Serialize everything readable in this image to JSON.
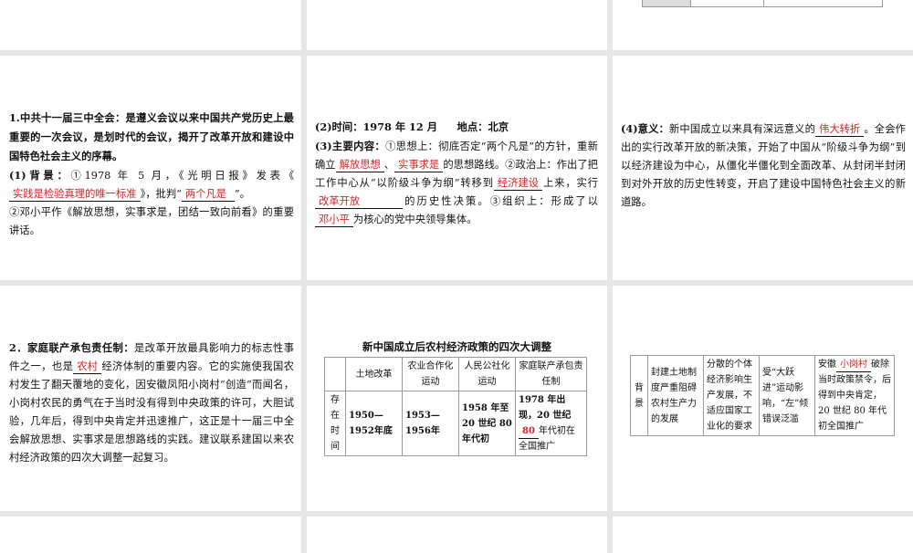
{
  "slides": {
    "s1": {
      "heading": "1.中共十一届三中全会：",
      "text1": "是遵义会议以来中国共产党历史上最重要的一次会议，是划时代的会议，揭开了改革开放和建设中国特色社会主义的序幕。",
      "bg_label": "(1)背景：",
      "bg_text1": "①1978 年 5 月，《光明日报》发表《",
      "blank1": "实践是检验真理的唯一标准",
      "bg_text2": "》，批判“",
      "blank2": "两个凡是",
      "bg_text3": "”。",
      "text2": "②邓小平作《解放思想，实事求是，团结一致向前看》的重要讲话。"
    },
    "s2": {
      "time": "(2)时间：1978 年 12 月",
      "place": "地点：北京",
      "c_label": "(3)主要内容：",
      "t1": "①思想上：彻底否定“两个凡是”的方针，重新确立",
      "b1": "解放思想",
      "t2": "、",
      "b2": "实事求是",
      "t3": "的思想路线。②政治上：作出了把工作中心从“以阶级斗争为纲”转移到",
      "b3": "经济建设",
      "t4": "上来，实行",
      "b4": "改革开放",
      "t5": "的历史性决策。③组织上：形成了以",
      "b5": "邓小平",
      "t6": "为核心的党中央领导集体。"
    },
    "s3": {
      "label": "(4)意义：",
      "t1": "新中国成立以来具有深远意义的",
      "b1": "伟大转折",
      "t2": "。全会作出的实行改革开放的新决策，开始了中国从“阶级斗争为纲”到以经济建设为中心，从僵化半僵化到全面改革、从封闭半封闭到对外开放的历史性转变，开启了建设中国特色社会主义的新道路。"
    },
    "s4": {
      "heading": "2．家庭联产承包责任制：",
      "t1": "是改革开放最具影响力的标志性事件之一，也是",
      "b1": "农村",
      "t2": "经济体制的重要内容。它的实施使我国农村发生了翻天覆地的变化，因安徽凤阳小岗村“创造”而闻名，小岗村农民的勇气在于当时没有得到中央政策的许可，大胆试验，几年后，得到中央肯定并迅速推广，这正是十一届三中全会解放思想、实事求是思想路线的实践。建议联系建国以来农村经济政策的四次大调整一起复习。"
    },
    "s5": {
      "title": "新中国成立后农村经济政策的四次大调整",
      "headers": [
        "",
        "土地改革",
        "农业合作化运动",
        "人民公社化运动",
        "家庭联产承包责任制"
      ],
      "row_label": "存在时间",
      "cells": [
        "1950—1952年底",
        "1953—1956年",
        "1958 年至 20 世纪 80 年代初"
      ],
      "last_a": "1978 年出现，20 世纪",
      "last_blank": "80",
      "last_b": "年代初在全国推广"
    },
    "s6": {
      "row_label": "背景",
      "cells": [
        "封建土地制度严重阻碍农村生产力的发展",
        "分散的个体经济影响生产发展，不适应国家工业化的要求",
        "受“大跃进”运动影响，“左”倾错误泛滥"
      ],
      "last_a": "安徽",
      "last_blank": "小岗村",
      "last_b": "破除当时政策禁令，后得到中央肯定，20 世纪 80 年代初全国推广"
    }
  }
}
